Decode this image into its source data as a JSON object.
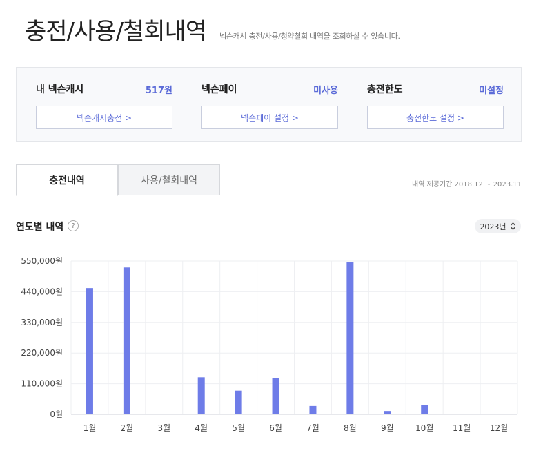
{
  "header": {
    "title": "충전/사용/철회내역",
    "description": "넥슨캐시 충전/사용/청약철회 내역을 조회하실 수 있습니다."
  },
  "summary": {
    "cash": {
      "label": "내 넥슨캐시",
      "value": "517원",
      "button": "넥슨캐시충전 >"
    },
    "pay": {
      "label": "넥슨페이",
      "value": "미사용",
      "button": "넥슨페이 설정 >"
    },
    "limit": {
      "label": "충전한도",
      "value": "미설정",
      "button": "충전한도 설정 >"
    }
  },
  "tabs": {
    "charge": "충전내역",
    "usage": "사용/철회내역",
    "period": "내역 제공기간 2018.12 ~ 2023.11"
  },
  "section": {
    "title": "연도별 내역",
    "help_icon": "?",
    "year": "2023년",
    "year_icon": "updown-chevron-icon"
  },
  "colors": {
    "accent": "#5b6bd8",
    "bar": "#6e7ce8"
  },
  "chart_data": {
    "type": "bar",
    "categories": [
      "1월",
      "2월",
      "3월",
      "4월",
      "5월",
      "6월",
      "7월",
      "8월",
      "9월",
      "10월",
      "11월",
      "12월"
    ],
    "values": [
      453000,
      527000,
      0,
      133000,
      85000,
      131000,
      30000,
      545000,
      12000,
      33000,
      0,
      0
    ],
    "y_ticks": [
      "0원",
      "110,000원",
      "220,000원",
      "330,000원",
      "440,000원",
      "550,000원"
    ],
    "y_tick_values": [
      0,
      110000,
      220000,
      330000,
      440000,
      550000
    ],
    "ylim": [
      0,
      550000
    ],
    "grid": true
  }
}
